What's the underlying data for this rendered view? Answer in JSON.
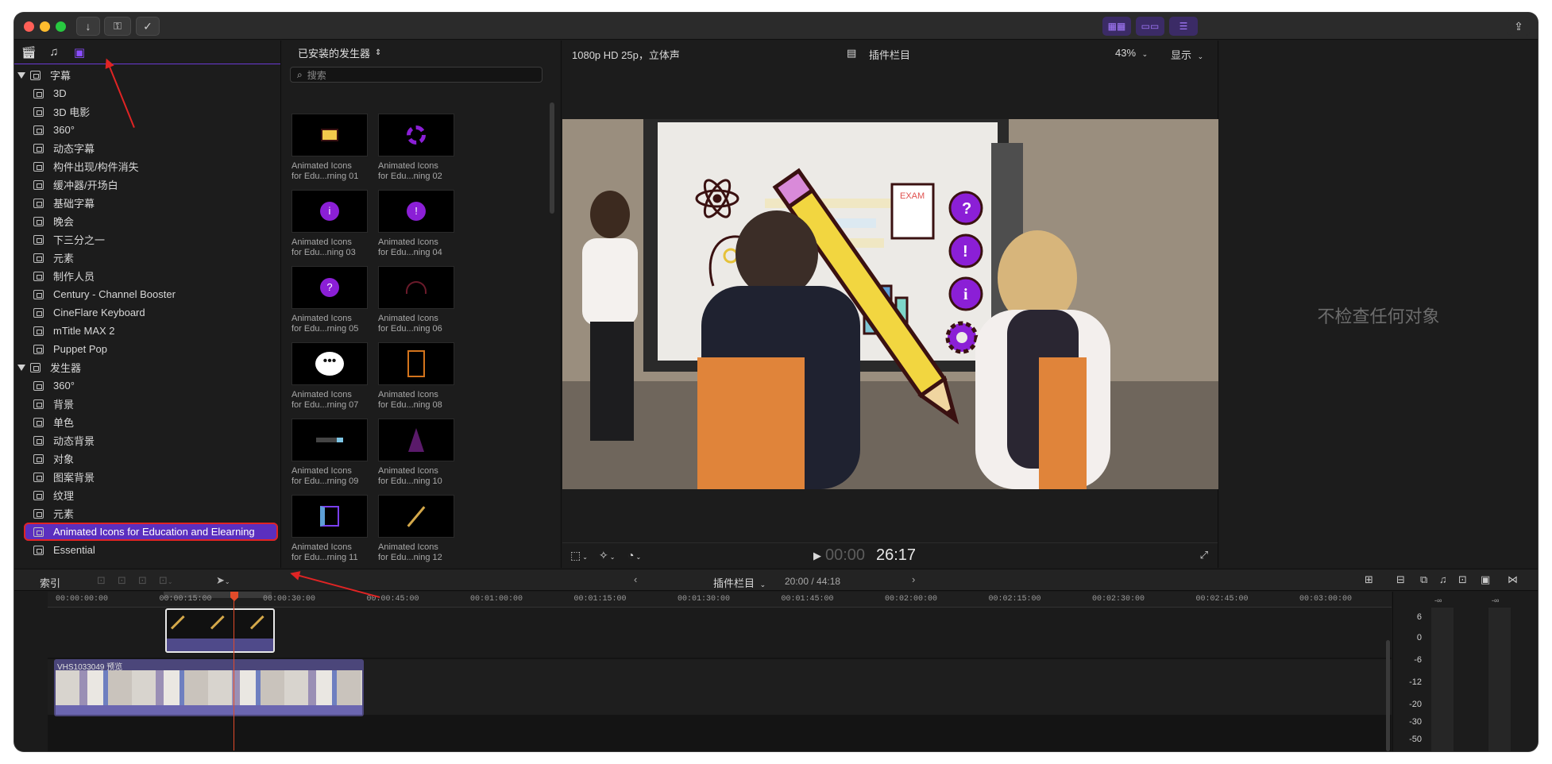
{
  "sidebar": {
    "groups": [
      {
        "label": "字幕",
        "items": [
          "3D",
          "3D 电影",
          "360°",
          "动态字幕",
          "构件出现/构件消失",
          "缓冲器/开场白",
          "基础字幕",
          "晚会",
          "下三分之一",
          "元素",
          "制作人员",
          "Century - Channel Booster",
          "CineFlare Keyboard",
          "mTitle MAX 2",
          "Puppet Pop"
        ]
      },
      {
        "label": "发生器",
        "items": [
          "360°",
          "背景",
          "单色",
          "动态背景",
          "对象",
          "图案背景",
          "纹理",
          "元素",
          "Animated Icons for Education and Elearning",
          "Essential"
        ]
      }
    ]
  },
  "browser": {
    "title": "已安装的发生器",
    "search_placeholder": "搜索",
    "items": [
      {
        "line1": "Animated Icons",
        "line2": "for Edu...rning 01",
        "icon": "envelope-icon"
      },
      {
        "line1": "Animated Icons",
        "line2": "for Edu...ning 02",
        "icon": "gear-icon"
      },
      {
        "line1": "Animated Icons",
        "line2": "for Edu...ning 03",
        "icon": "info-icon"
      },
      {
        "line1": "Animated Icons",
        "line2": "for Edu...ning 04",
        "icon": "exclamation-icon"
      },
      {
        "line1": "Animated Icons",
        "line2": "for Edu...rning 05",
        "icon": "question-icon"
      },
      {
        "line1": "Animated Icons",
        "line2": "for Edu...ning 06",
        "icon": "headphones-icon"
      },
      {
        "line1": "Animated Icons",
        "line2": "for Edu...rning 07",
        "icon": "chat-bubble-icon"
      },
      {
        "line1": "Animated Icons",
        "line2": "for Edu...ning 08",
        "icon": "clipboard-icon"
      },
      {
        "line1": "Animated Icons",
        "line2": "for Edu...rning 09",
        "icon": "usb-stick-icon"
      },
      {
        "line1": "Animated Icons",
        "line2": "for Edu...ning 10",
        "icon": "compass-icon"
      },
      {
        "line1": "Animated Icons",
        "line2": "for Edu...rning 11",
        "icon": "book-icon"
      },
      {
        "line1": "Animated Icons",
        "line2": "for Edu...ning 12",
        "icon": "pencil-icon"
      }
    ]
  },
  "viewer": {
    "format": "1080p HD 25p，立体声",
    "title": "插件栏目",
    "zoom": "43%",
    "display_label": "显示",
    "timecode_dim": "00:00",
    "timecode": "26:17",
    "exam_text": "EXAM"
  },
  "inspector": {
    "empty_text": "不检查任何对象"
  },
  "timeline": {
    "index_label": "索引",
    "project_name": "插件栏目",
    "position": "20:00 / 44:18",
    "ruler_labels": [
      "00:00:00:00",
      "00:00:15:00",
      "00:00:30:00",
      "00:00:45:00",
      "00:01:00:00",
      "00:01:15:00",
      "00:01:30:00",
      "00:01:45:00",
      "00:02:00:00",
      "00:02:15:00",
      "00:02:30:00",
      "00:02:45:00",
      "00:03:00:00"
    ],
    "clip_name": "VHS1033049 预览"
  },
  "meters": {
    "scale": [
      "6",
      "0",
      "-6",
      "-12",
      "-20",
      "-30",
      "-50"
    ],
    "peak_left": "-∞",
    "peak_right": "-∞"
  },
  "colors": {
    "accent": "#7a3ff0",
    "selection": "#5b2fbf",
    "highlight_red": "#e02424",
    "icon_purple": "#8b1fd6"
  }
}
